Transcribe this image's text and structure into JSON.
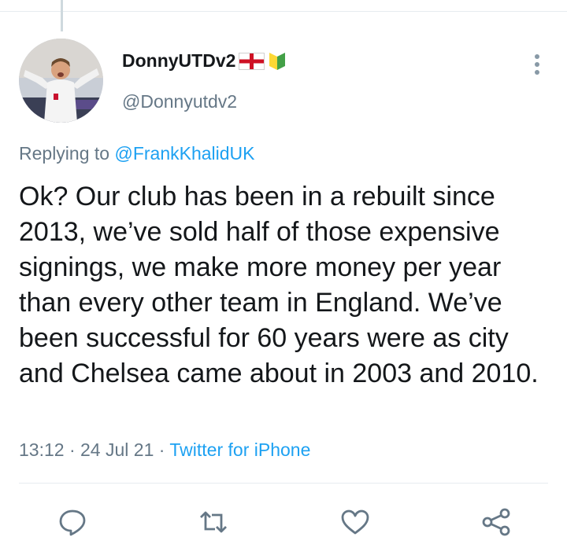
{
  "tweet": {
    "display_name": "DonnyUTDv2",
    "handle": "@Donnyutdv2",
    "replying_prefix": "Replying to",
    "replying_to": "@FrankKhalidUK",
    "text": "Ok? Our club has been in a rebuilt since 2013, we’ve sold half of those expensive signings, we make more money per year than every other team in England. We’ve been successful for 60 years were as city and Chelsea came about in 2003 and 2010.",
    "time": "13:12",
    "date": "24 Jul 21",
    "separator": " · ",
    "source": "Twitter for iPhone"
  },
  "icons": {
    "name_emojis": [
      "england-flag-icon",
      "beginner-badge-icon"
    ],
    "more": "more-vertical-icon",
    "actions": [
      "reply-icon",
      "retweet-icon",
      "like-icon",
      "share-icon"
    ]
  },
  "colors": {
    "accent": "#1da1f2",
    "muted": "#657786",
    "text": "#14171a",
    "divider": "#e6ecf0"
  }
}
